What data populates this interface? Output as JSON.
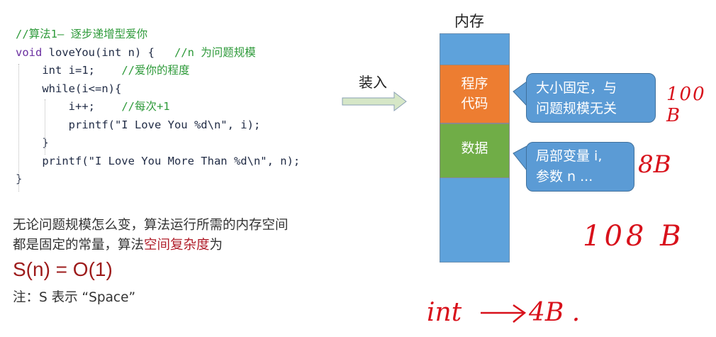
{
  "code": {
    "lines": [
      {
        "code": "",
        "comment": "//算法1— 逐步递增型爱你"
      },
      {
        "kw": "void",
        "code": " loveYou(int n) {   ",
        "comment": "//n 为问题规模"
      },
      {
        "kw": "",
        "code": "    int i=1;    ",
        "comment": "//爱你的程度"
      },
      {
        "kw": "",
        "code": "    while(i<=n){",
        "comment": ""
      },
      {
        "kw": "",
        "code": "        i++;    ",
        "comment": "//每次+1"
      },
      {
        "kw": "",
        "code": "        printf(\"I Love You %d\\n\", i);",
        "comment": ""
      },
      {
        "kw": "",
        "code": "    }",
        "comment": ""
      },
      {
        "kw": "",
        "code": "    printf(\"I Love You More Than %d\\n\", n);",
        "comment": ""
      },
      {
        "kw": "",
        "code": "}",
        "comment": ""
      }
    ]
  },
  "explanation": {
    "line1": "无论问题规模怎么变，算法运行所需的内存空间",
    "line2_a": "都是固定的常量，算法",
    "line2_highlight": "空间复杂度",
    "line2_b": "为",
    "highlight_color": "#b01e2a"
  },
  "formula": "S(n) = O(1)",
  "note": "注：S 表示 “Space”",
  "diagram": {
    "load_label": "装入",
    "memory_title": "内存",
    "segment_code": [
      "程序",
      "代码"
    ],
    "segment_data": "数据",
    "bubble_code": [
      "大小固定，与",
      "问题规模无关"
    ],
    "bubble_data": [
      "局部变量 i,",
      "参数 n ..."
    ],
    "colors": {
      "memory": "#5ea2db",
      "code_segment": "#ed7d31",
      "data_segment": "#70ad47",
      "bubble": "#5b9bd5",
      "handwriting": "#d8111b"
    }
  },
  "handwriting": {
    "code_size": "100 B",
    "data_size": "8B",
    "total": "108 B",
    "int_label": "int",
    "int_size": "4B ."
  }
}
